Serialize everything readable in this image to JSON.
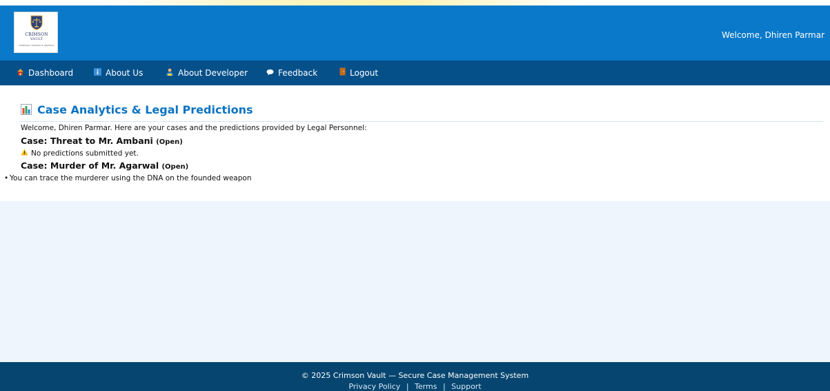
{
  "brand": {
    "logo_title": "CRIMSON",
    "logo_subtitle": "VAULT",
    "logo_tagline": "FORENSIC EVIDENCE ARCHIVE"
  },
  "header": {
    "welcome": "Welcome, Dhiren Parmar"
  },
  "nav": {
    "items": [
      {
        "label": "Dashboard",
        "icon": "house-icon"
      },
      {
        "label": "About Us",
        "icon": "info-icon"
      },
      {
        "label": "About Developer",
        "icon": "developer-icon"
      },
      {
        "label": "Feedback",
        "icon": "speech-bubble-icon"
      },
      {
        "label": "Logout",
        "icon": "door-icon"
      }
    ]
  },
  "page": {
    "title": "Case Analytics & Legal Predictions",
    "intro": "Welcome, Dhiren Parmar. Here are your cases and the predictions provided by Legal Personnel:",
    "cases": [
      {
        "title": "Case: Threat to Mr. Ambani",
        "status": "(Open)",
        "message": "No predictions submitted yet."
      },
      {
        "title": "Case: Murder of Mr. Agarwal",
        "status": "(Open)",
        "predictions": [
          "You can trace the murderer using the DNA on the founded weapon"
        ]
      }
    ]
  },
  "footer": {
    "copyright": "© 2025 Crimson Vault — Secure Case Management System",
    "links": [
      "Privacy Policy",
      "Terms",
      "Support"
    ],
    "separator": "|"
  },
  "colors": {
    "header_bg": "#0a79c9",
    "nav_bg": "#06508a",
    "title": "#0b73c2",
    "footer_bg": "#06456f",
    "page_bg": "#eef5fc"
  }
}
